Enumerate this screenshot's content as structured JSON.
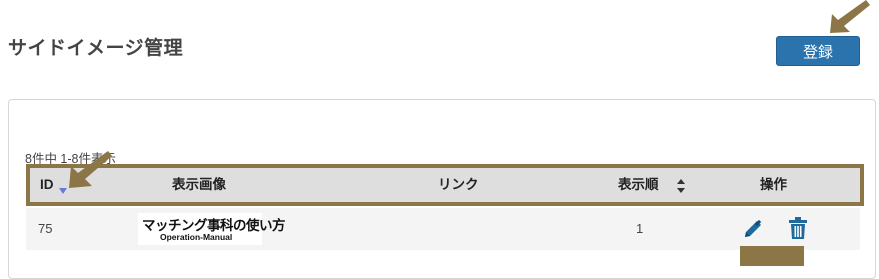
{
  "page": {
    "title": "サイドイメージ管理"
  },
  "toolbar": {
    "register_label": "登録"
  },
  "listing": {
    "count_text": "8件中 1-8件表示"
  },
  "table": {
    "columns": {
      "id": "ID",
      "image": "表示画像",
      "link": "リンク",
      "order": "表示順",
      "actions": "操作"
    },
    "rows": [
      {
        "id": "75",
        "image_title": "マッチング事科の使い方",
        "image_subtitle": "Operation-Manual",
        "link": "",
        "order": "1"
      }
    ]
  },
  "colors": {
    "accent": "#2a73ad",
    "annotation": "#8c7648",
    "header_bg": "#dedede",
    "sort_icon": "#6a7bd6"
  },
  "icons": [
    "sort-desc-icon",
    "sort-both-icon",
    "pencil-icon",
    "trash-icon",
    "annotation-arrow-icon"
  ]
}
